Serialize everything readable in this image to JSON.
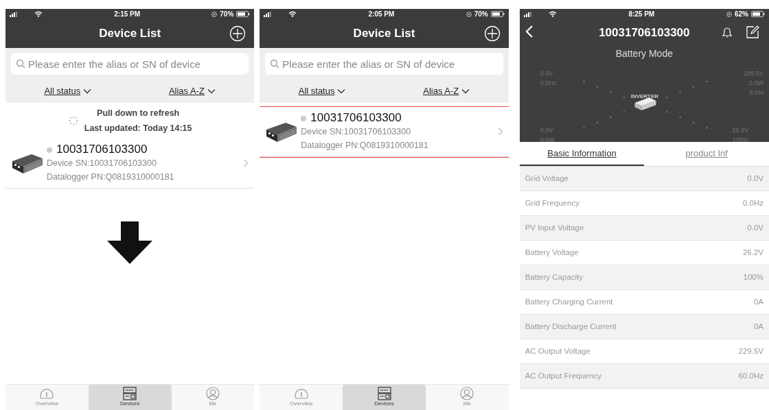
{
  "screens": [
    {
      "kind": "list",
      "status_bar": {
        "time": "2:15 PM",
        "battery": "70%"
      },
      "title": "Device List",
      "search": {
        "placeholder": "Please enter the alias or SN of device"
      },
      "filters": [
        "All status",
        "Alias A-Z"
      ],
      "refresh": {
        "title": "Pull down to refresh",
        "updated": "Last updated: Today 14:15"
      },
      "devices": [
        {
          "name": "10031706103300",
          "sn": "Device SN:10031706103300",
          "pn": "Datalogger PN:Q0819310000181",
          "highlighted": false
        }
      ],
      "down_arrow": true,
      "tabs": [
        {
          "label": "Overview",
          "selected": false
        },
        {
          "label": "Devices",
          "selected": true
        },
        {
          "label": "Me",
          "selected": false
        }
      ]
    },
    {
      "kind": "list",
      "status_bar": {
        "time": "2:05 PM",
        "battery": "70%"
      },
      "title": "Device List",
      "search": {
        "placeholder": "Please enter the alias or SN of device"
      },
      "filters": [
        "All status",
        "Alias A-Z"
      ],
      "devices": [
        {
          "name": "10031706103300",
          "sn": "Device SN:10031706103300",
          "pn": "Datalogger PN:Q0819310000181",
          "highlighted": true
        }
      ],
      "tabs": [
        {
          "label": "Overview",
          "selected": false
        },
        {
          "label": "Devices",
          "selected": true
        },
        {
          "label": "Me",
          "selected": false
        }
      ]
    },
    {
      "kind": "detail",
      "status_bar": {
        "time": "8:25 PM",
        "battery": "62%"
      },
      "title": "10031706103300",
      "mode": "Battery Mode",
      "diagram": {
        "inverter": "INVERTER",
        "grid": [
          "0.0V",
          "0.0Hz"
        ],
        "load": [
          "229.5V",
          "0.0W",
          "0.0%"
        ],
        "solar": [
          "0.0V",
          "0.0W"
        ],
        "battery": [
          "26.2V",
          "100%"
        ]
      },
      "info_tabs": [
        {
          "label": "Basic Information",
          "selected": true
        },
        {
          "label": "product Inf",
          "selected": false
        }
      ],
      "rows": [
        {
          "label": "Grid Voltage",
          "value": "0.0V"
        },
        {
          "label": "Grid Frequency",
          "value": "0.0Hz"
        },
        {
          "label": "PV Input Voltage",
          "value": "0.0V"
        },
        {
          "label": "Battery Voltage",
          "value": "26.2V"
        },
        {
          "label": "Battery Capacity",
          "value": "100%"
        },
        {
          "label": "Battery Charging Current",
          "value": "0A"
        },
        {
          "label": "Battery Discharge Current",
          "value": "0A"
        },
        {
          "label": "AC Output Voltage",
          "value": "229.5V"
        },
        {
          "label": "AC Output Frequency",
          "value": "60.0Hz"
        }
      ]
    }
  ]
}
